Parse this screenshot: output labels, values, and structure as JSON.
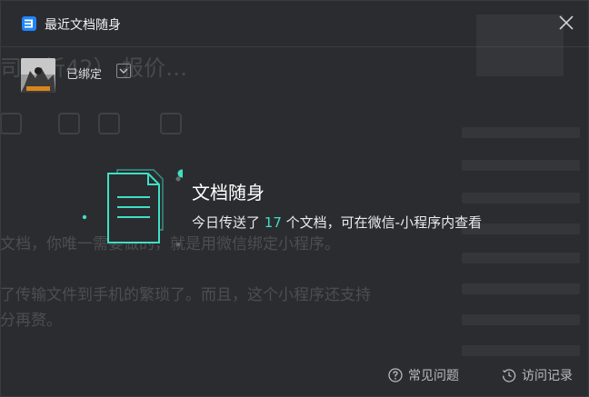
{
  "window": {
    "title": "最近文档随身",
    "close_icon": "close-icon",
    "logo_icon": "document-app-icon",
    "brand_color": "#1e86ff"
  },
  "account": {
    "status_label": "已绑定",
    "avatar_icon": "avatar-image",
    "dropdown_icon": "chevron-down-icon"
  },
  "main": {
    "illustration_icon": "document-icon",
    "headline": "文档随身",
    "desc_prefix": "今日传送了",
    "desc_count": "17",
    "desc_suffix": "个文档，可在微信-小程序内查看",
    "accent_color": "#3ee0c4"
  },
  "footer": {
    "faq_label": "常见问题",
    "faq_icon": "question-circle-icon",
    "history_label": "访问记录",
    "history_icon": "history-clock-icon"
  }
}
